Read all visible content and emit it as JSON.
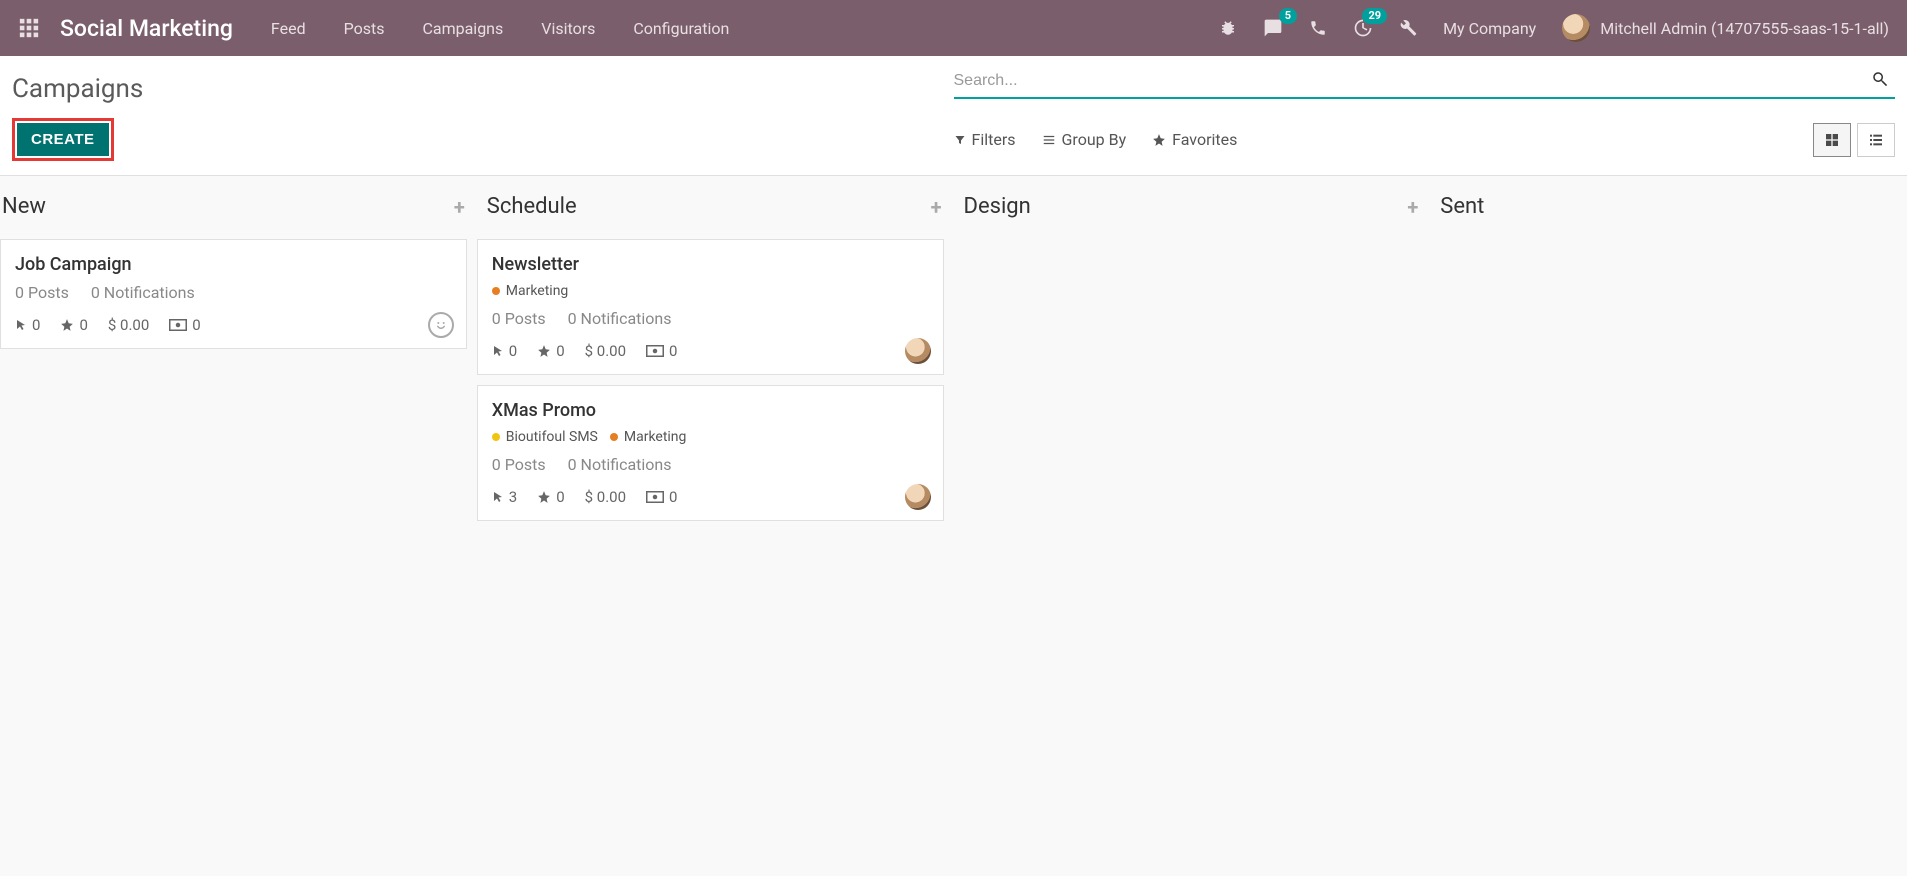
{
  "nav": {
    "brand": "Social Marketing",
    "links": [
      "Feed",
      "Posts",
      "Campaigns",
      "Visitors",
      "Configuration"
    ],
    "msg_badge": "5",
    "activity_badge": "29",
    "company": "My Company",
    "user": "Mitchell Admin (14707555-saas-15-1-all)"
  },
  "control": {
    "title": "Campaigns",
    "create": "CREATE",
    "search_placeholder": "Search...",
    "filters": "Filters",
    "groupby": "Group By",
    "favorites": "Favorites"
  },
  "columns": [
    {
      "title": "New"
    },
    {
      "title": "Schedule"
    },
    {
      "title": "Design"
    },
    {
      "title": "Sent"
    }
  ],
  "tag_colors": {
    "marketing": "#E67E22",
    "bioutifoul": "#F1C40F"
  },
  "cards": {
    "new": [
      {
        "title": "Job Campaign",
        "posts": "0 Posts",
        "notifications": "0 Notifications",
        "clicks": "0",
        "stars": "0",
        "revenue": "$ 0.00",
        "quotes": "0",
        "face": "smile"
      }
    ],
    "schedule": [
      {
        "title": "Newsletter",
        "tags": [
          {
            "label": "Marketing",
            "color": "marketing"
          }
        ],
        "posts": "0 Posts",
        "notifications": "0 Notifications",
        "clicks": "0",
        "stars": "0",
        "revenue": "$ 0.00",
        "quotes": "0",
        "face": "avatar"
      },
      {
        "title": "XMas Promo",
        "tags": [
          {
            "label": "Bioutifoul SMS",
            "color": "bioutifoul"
          },
          {
            "label": "Marketing",
            "color": "marketing"
          }
        ],
        "posts": "0 Posts",
        "notifications": "0 Notifications",
        "clicks": "3",
        "stars": "0",
        "revenue": "$ 0.00",
        "quotes": "0",
        "face": "avatar"
      }
    ]
  }
}
